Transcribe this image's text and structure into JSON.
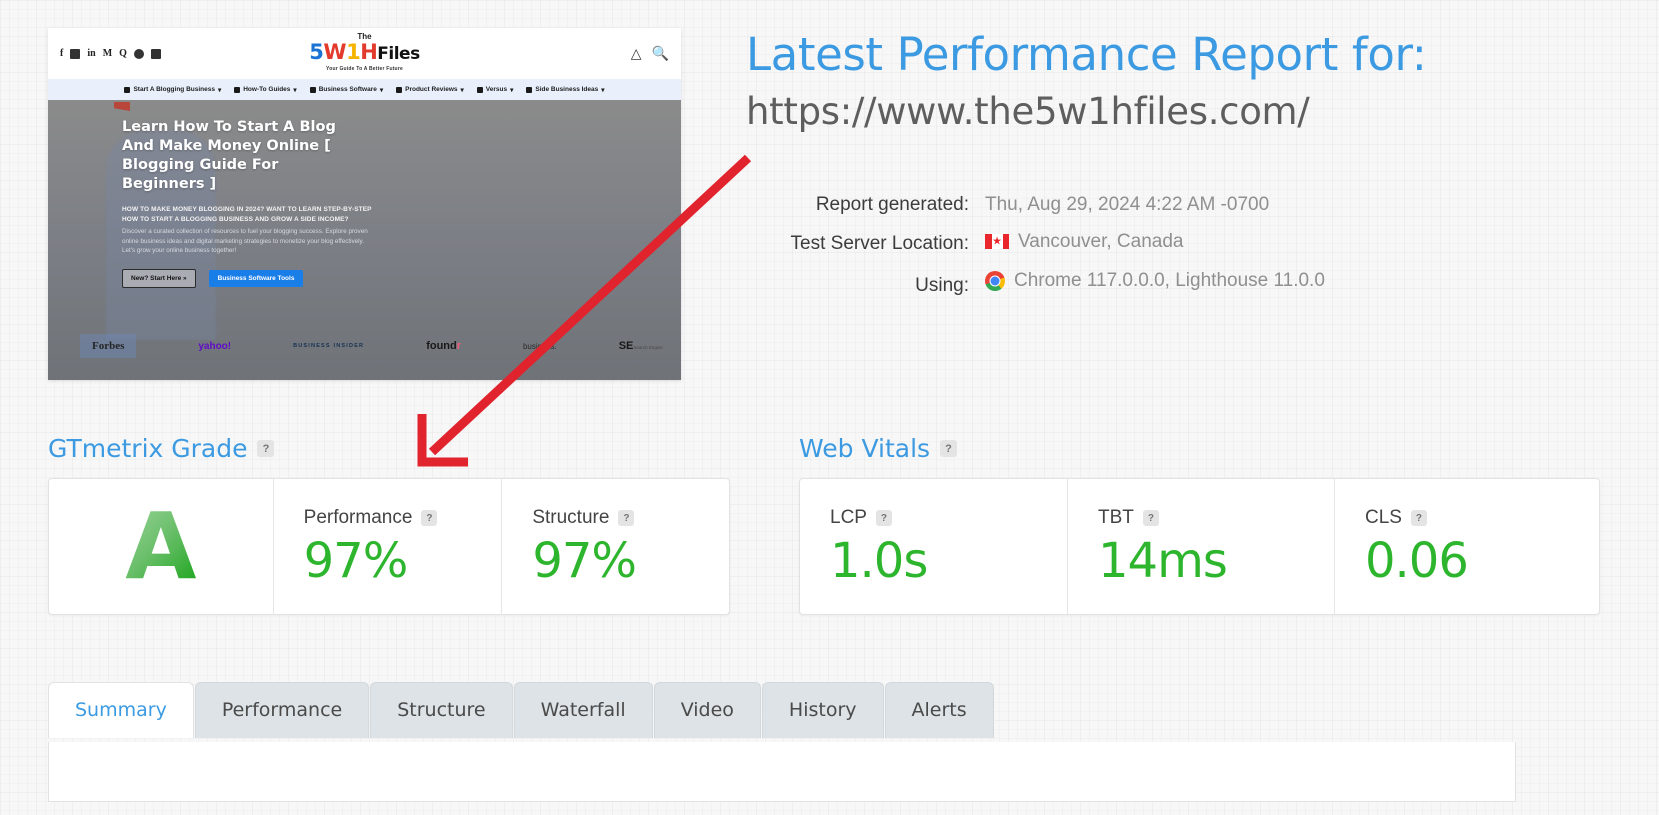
{
  "header": {
    "title": "Latest Performance Report for:",
    "url": "https://www.the5w1hfiles.com/",
    "accent_color": "#3b9ae1"
  },
  "meta": {
    "report_generated_label": "Report generated:",
    "report_generated_value": "Thu, Aug 29, 2024 4:22 AM -0700",
    "test_server_label": "Test Server Location:",
    "test_server_value": "Vancouver, Canada",
    "using_label": "Using:",
    "using_value": "Chrome 117.0.0.0, Lighthouse 11.0.0"
  },
  "gtmetrix_grade": {
    "section_title": "GTmetrix Grade",
    "help": "?",
    "grade": "A",
    "grade_color": "#2db52d",
    "metrics": [
      {
        "label": "Performance",
        "help": "?",
        "value": "97%"
      },
      {
        "label": "Structure",
        "help": "?",
        "value": "97%"
      }
    ]
  },
  "web_vitals": {
    "section_title": "Web Vitals",
    "help": "?",
    "metrics": [
      {
        "label": "LCP",
        "help": "?",
        "value": "1.0s"
      },
      {
        "label": "TBT",
        "help": "?",
        "value": "14ms"
      },
      {
        "label": "CLS",
        "help": "?",
        "value": "0.06"
      }
    ]
  },
  "tabs": [
    {
      "label": "Summary",
      "active": true
    },
    {
      "label": "Performance",
      "active": false
    },
    {
      "label": "Structure",
      "active": false
    },
    {
      "label": "Waterfall",
      "active": false
    },
    {
      "label": "Video",
      "active": false
    },
    {
      "label": "History",
      "active": false
    },
    {
      "label": "Alerts",
      "active": false
    }
  ],
  "thumbnail": {
    "logo": {
      "the": "The",
      "five": "5",
      "w": "W",
      "one": "1",
      "h": "H",
      "files": "Files",
      "tagline": "Your Guide To A Better Future"
    },
    "nav_items": [
      "Start A Blogging Business",
      "How-To Guides",
      "Business Software",
      "Product Reviews",
      "Versus",
      "Side Business Ideas"
    ],
    "hero_heading": "Learn How To Start A Blog And Make Money Online [ Blogging Guide For Beginners ]",
    "hero_kicker": "HOW TO MAKE MONEY BLOGGING IN 2024? WANT TO LEARN STEP-BY-STEP HOW TO START A BLOGGING BUSINESS AND GROW A SIDE INCOME?",
    "hero_paragraph": "Discover a curated collection of resources to fuel your blogging success. Explore proven online business ideas and digital marketing strategies to monetize your blog effectively. Let's grow your online business together!",
    "btn_primary": "New? Start Here »",
    "btn_secondary": "Business Software Tools",
    "press_logos": [
      "Forbes",
      "yahoo!",
      "BUSINESS INSIDER",
      "foundr",
      "business.",
      "SE"
    ]
  },
  "annotation": {
    "arrow_color": "#e1232d"
  }
}
